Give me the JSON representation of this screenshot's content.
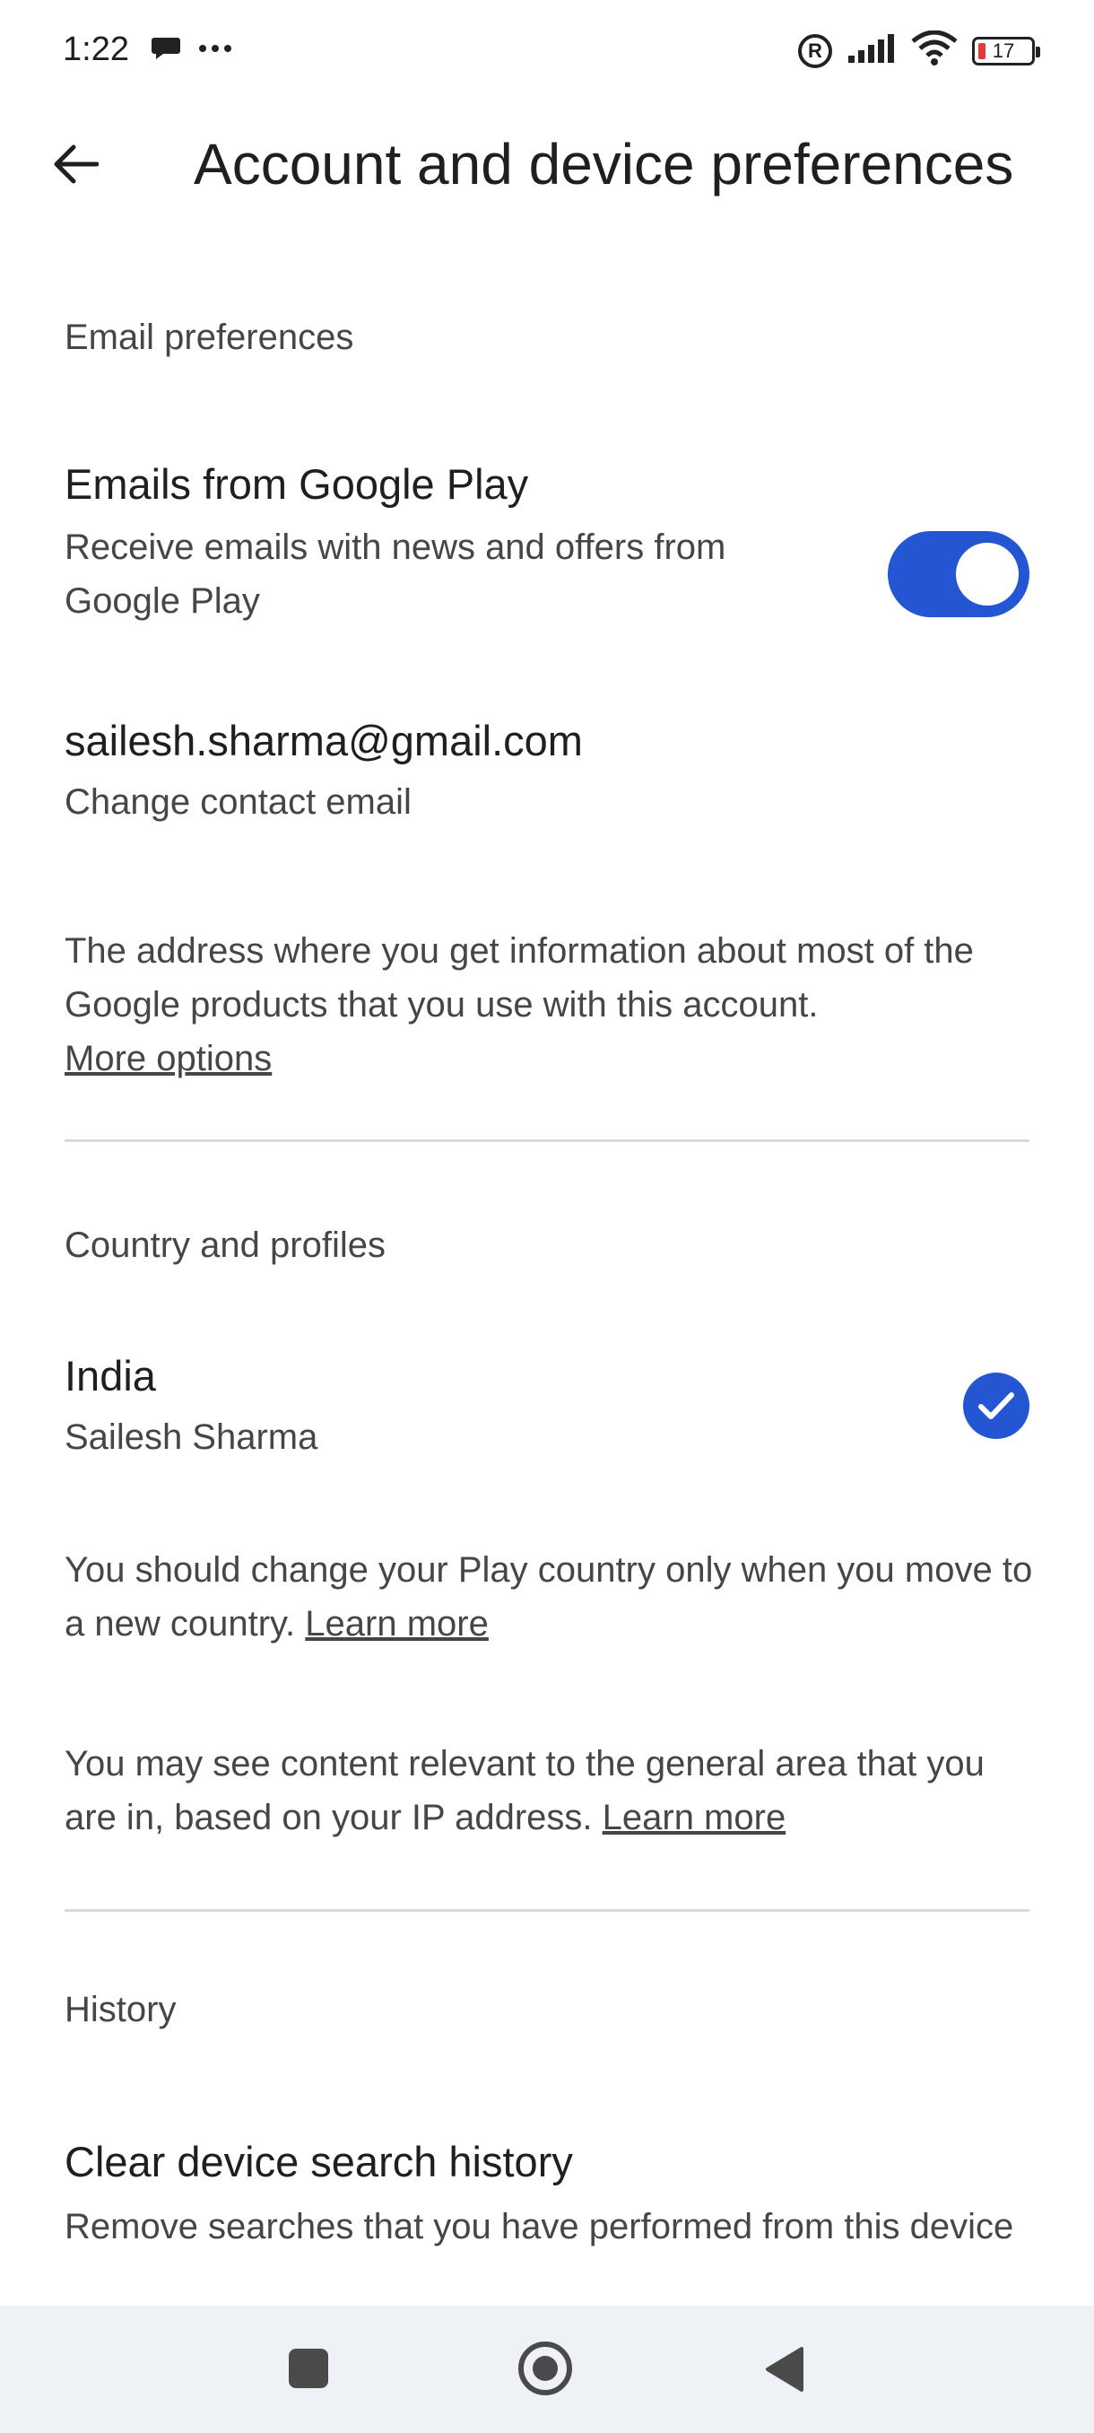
{
  "status_bar": {
    "time": "1:22",
    "battery": "17",
    "icons": [
      "chat-bubble-icon",
      "more-dots-icon",
      "registered-icon",
      "signal-icon",
      "wifi-icon",
      "battery-icon"
    ]
  },
  "header": {
    "title": "Account and device preferences"
  },
  "email_section": {
    "heading": "Email preferences",
    "emails_toggle": {
      "title": "Emails from Google Play",
      "subtitle": "Receive emails with news and offers from Google Play",
      "enabled": true
    },
    "contact": {
      "email": "sailesh.sharma@gmail.com",
      "action": "Change contact email"
    },
    "info": "The address where you get information about most of the Google products that you use with this account.",
    "more_options": "More options"
  },
  "country_section": {
    "heading": "Country and profiles",
    "country": "India",
    "profile_name": "Sailesh Sharma",
    "selected": true,
    "info1": "You should change your Play country only when you move to a new country.",
    "info1_link": "Learn more",
    "info2": "You may see content relevant to the general area that you are in, based on your IP address.",
    "info2_link": "Learn more"
  },
  "history_section": {
    "heading": "History",
    "clear": {
      "title": "Clear device search history",
      "subtitle": "Remove searches that you have performed from this device"
    }
  },
  "colors": {
    "accent": "#2456d3",
    "text_primary": "#1f1f1f",
    "text_secondary": "#444746",
    "divider": "#d7d9dc",
    "navbar_bg": "#eef1f6"
  }
}
